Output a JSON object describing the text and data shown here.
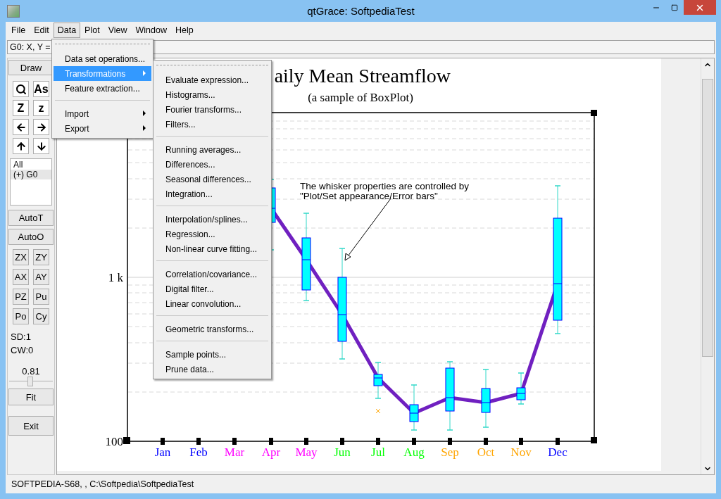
{
  "window": {
    "title": "qtGrace: SoftpediaTest"
  },
  "menu_bar": [
    {
      "label": "File",
      "selected": false
    },
    {
      "label": "Edit",
      "selected": false
    },
    {
      "label": "Data",
      "selected": true
    },
    {
      "label": "Plot",
      "selected": false
    },
    {
      "label": "View",
      "selected": false
    },
    {
      "label": "Window",
      "selected": false
    },
    {
      "label": "Help",
      "selected": false
    }
  ],
  "command_line": {
    "value": "G0: X, Y ="
  },
  "data_menu": [
    {
      "kind": "item",
      "label": "Data set operations...",
      "highlighted": false
    },
    {
      "kind": "submenu",
      "label": "Transformations",
      "highlighted": true
    },
    {
      "kind": "item",
      "label": "Feature extraction...",
      "highlighted": false
    },
    {
      "kind": "separator"
    },
    {
      "kind": "submenu",
      "label": "Import",
      "highlighted": false
    },
    {
      "kind": "submenu",
      "label": "Export",
      "highlighted": false
    }
  ],
  "transformations_menu": [
    {
      "kind": "item",
      "label": "Evaluate expression..."
    },
    {
      "kind": "item",
      "label": "Histograms..."
    },
    {
      "kind": "item",
      "label": "Fourier transforms..."
    },
    {
      "kind": "item",
      "label": "Filters..."
    },
    {
      "kind": "separator"
    },
    {
      "kind": "item",
      "label": "Running averages..."
    },
    {
      "kind": "item",
      "label": "Differences..."
    },
    {
      "kind": "item",
      "label": "Seasonal differences..."
    },
    {
      "kind": "item",
      "label": "Integration..."
    },
    {
      "kind": "separator"
    },
    {
      "kind": "item",
      "label": "Interpolation/splines..."
    },
    {
      "kind": "item",
      "label": "Regression..."
    },
    {
      "kind": "item",
      "label": "Non-linear curve fitting..."
    },
    {
      "kind": "separator"
    },
    {
      "kind": "item",
      "label": "Correlation/covariance..."
    },
    {
      "kind": "item",
      "label": "Digital filter..."
    },
    {
      "kind": "item",
      "label": "Linear convolution..."
    },
    {
      "kind": "separator"
    },
    {
      "kind": "item",
      "label": "Geometric transforms..."
    },
    {
      "kind": "separator"
    },
    {
      "kind": "item",
      "label": "Sample points..."
    },
    {
      "kind": "item",
      "label": "Prune data..."
    }
  ],
  "tool_panel": {
    "draw_button": "Draw",
    "icon_buttons": [
      {
        "kind": "magnifier"
      },
      {
        "kind": "label",
        "label": "As"
      },
      {
        "kind": "label",
        "label": "Z"
      },
      {
        "kind": "label",
        "label": "z"
      },
      {
        "kind": "left"
      },
      {
        "kind": "right"
      },
      {
        "kind": "up"
      },
      {
        "kind": "down"
      }
    ],
    "set_list": [
      {
        "label": "All",
        "selected": false
      },
      {
        "label": "(+) G0",
        "selected": true
      }
    ],
    "auto_buttons": [
      "AutoT",
      "AutoO"
    ],
    "grid_buttons": [
      "ZX",
      "ZY",
      "AX",
      "AY",
      "PZ",
      "Pu",
      "Po",
      "Cy"
    ],
    "status": [
      "SD:1",
      "CW:0"
    ],
    "zoom_slider": {
      "reading": "0.81",
      "level": 0.48
    },
    "fit_button": "Fit",
    "exit_button": "Exit"
  },
  "graph": {
    "title": "aily Mean Streamflow",
    "subtitle": "(a sample of BoxPlot)",
    "annotation": [
      "The whisker properties are controlled by",
      "\"Plot/Set appearance/Error bars\""
    ],
    "y_tick_labels": [
      "1 k",
      "100"
    ],
    "months": [
      {
        "label": "Jan",
        "color": "#0000ff"
      },
      {
        "label": "Feb",
        "color": "#0000ff"
      },
      {
        "label": "Mar",
        "color": "#ff00ff"
      },
      {
        "label": "Apr",
        "color": "#ff00ff"
      },
      {
        "label": "May",
        "color": "#ff00ff"
      },
      {
        "label": "Jun",
        "color": "#00ff00"
      },
      {
        "label": "Jul",
        "color": "#00ff00"
      },
      {
        "label": "Aug",
        "color": "#00ff00"
      },
      {
        "label": "Sep",
        "color": "#ffa500"
      },
      {
        "label": "Oct",
        "color": "#ffa500"
      },
      {
        "label": "Nov",
        "color": "#ffa500"
      },
      {
        "label": "Dec",
        "color": "#0000ff"
      }
    ]
  },
  "status_bar": "SOFTPEDIA-S68, , C:\\Softpedia\\SoftpediaTest"
}
